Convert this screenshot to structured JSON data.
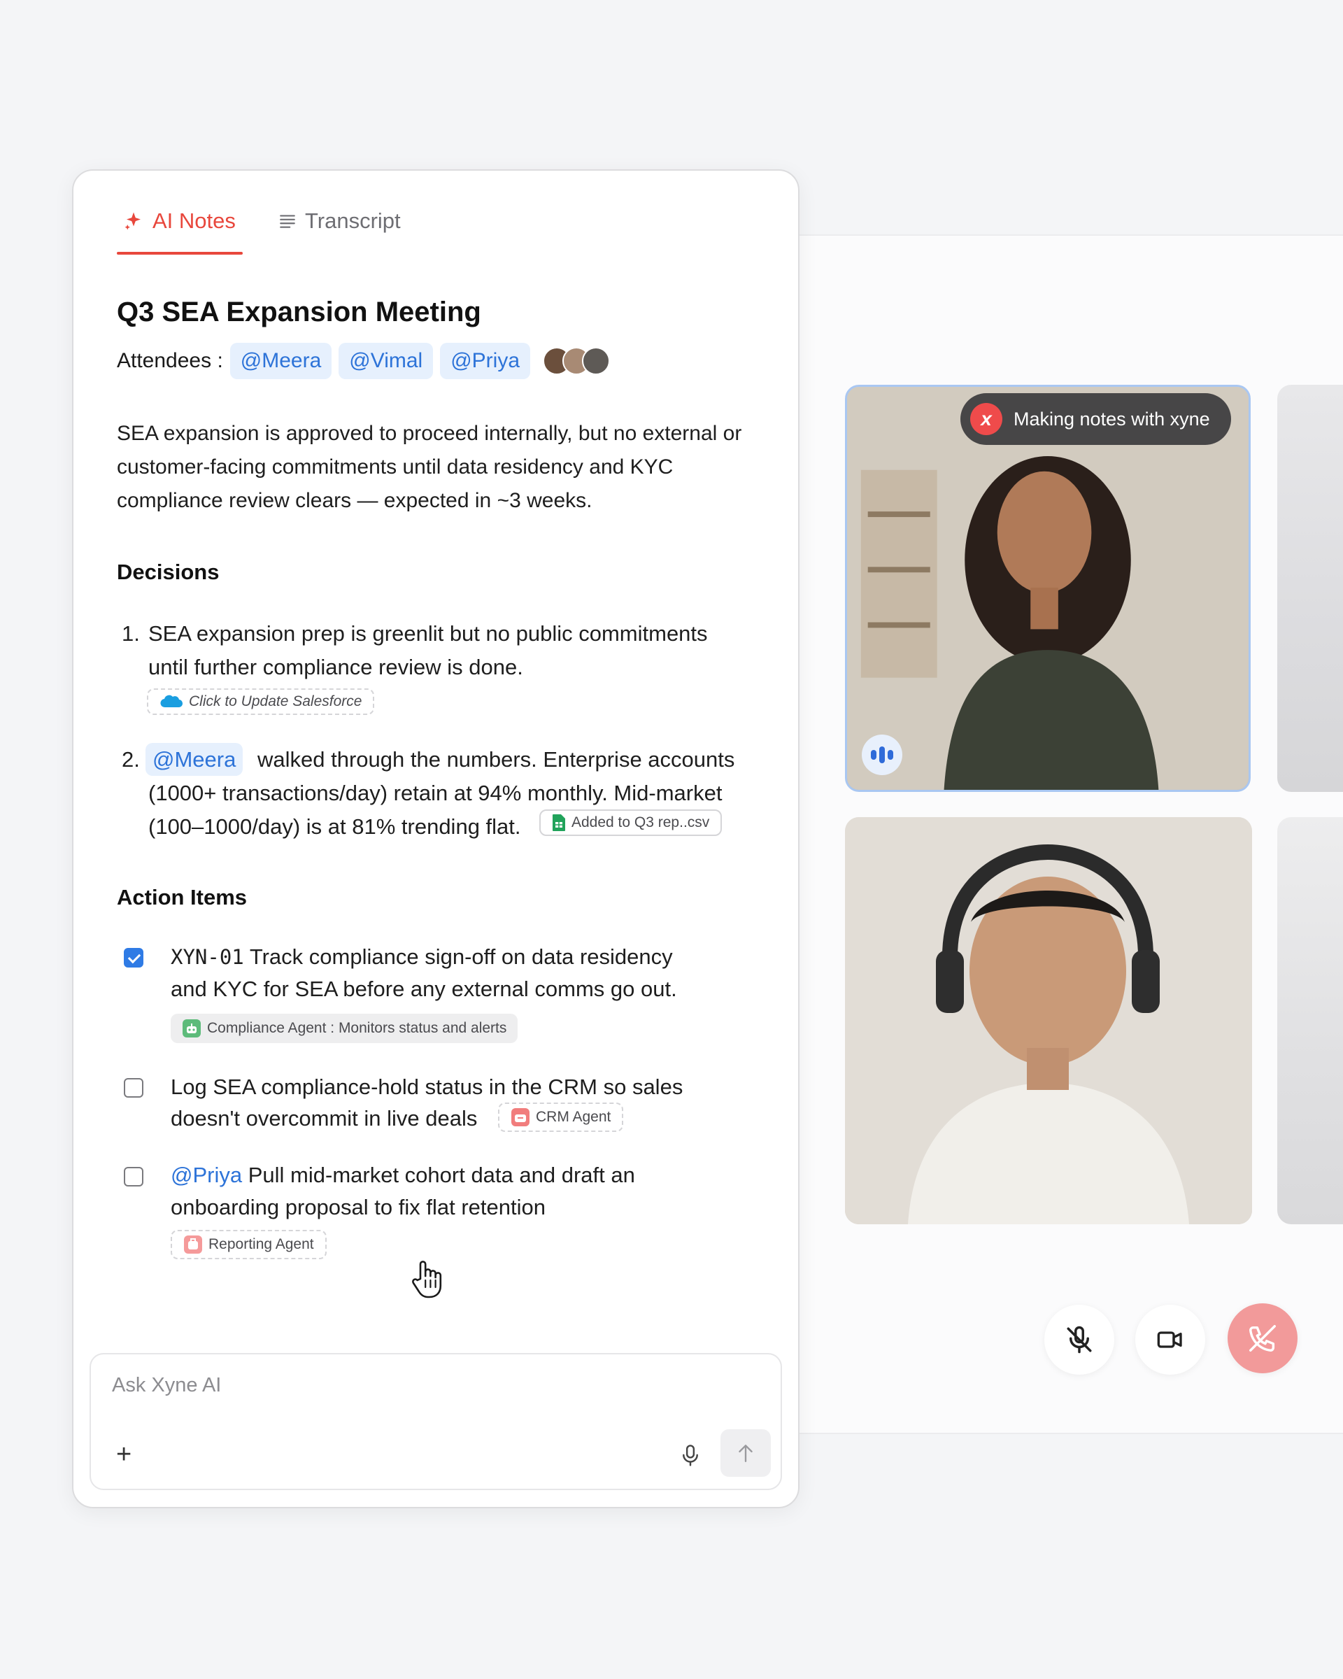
{
  "tabs": {
    "ai_notes": "AI Notes",
    "transcript": "Transcript"
  },
  "meeting": {
    "title": "Q3 SEA Expansion Meeting",
    "attendees_label": "Attendees :",
    "attendees": [
      "@Meera",
      "@Vimal",
      "@Priya"
    ],
    "summary": "SEA expansion is approved to proceed internally, but no external or customer-facing commitments until data residency and KYC compliance review clears — expected in ~3 weeks."
  },
  "decisions": {
    "heading": "Decisions",
    "items": [
      {
        "number": "1.",
        "line1": "SEA expansion prep is greenlit but no public commitments",
        "line2": "until further compliance review is done.",
        "chip": "Click to Update Salesforce"
      },
      {
        "number": "2.",
        "mention": "@Meera",
        "line1": "walked through the numbers. Enterprise accounts",
        "line2": "(1000+ transactions/day) retain at 94% monthly. Mid-market",
        "line3": "(100–1000/day) is at 81% trending flat.",
        "chip": "Added to Q3 rep..csv"
      }
    ]
  },
  "action_items": {
    "heading": "Action Items",
    "items": [
      {
        "checked": true,
        "code": "XYN-01",
        "line1": "Track compliance sign-off on data residency",
        "line2": "and KYC for SEA before any external comms go out.",
        "agent": "Compliance Agent : Monitors status and alerts"
      },
      {
        "checked": false,
        "line1": "Log SEA compliance-hold status in the CRM so sales",
        "line2": "doesn't overcommit in live deals",
        "agent": "CRM Agent"
      },
      {
        "checked": false,
        "mention": "@Priya",
        "line1": "Pull mid-market cohort data and draft an",
        "line2": "onboarding proposal to fix flat retention",
        "agent": "Reporting Agent"
      }
    ]
  },
  "composer": {
    "placeholder": "Ask Xyne AI",
    "plus": "+"
  },
  "call": {
    "notes_badge": "Making notes with xyne",
    "logo_letter": "x"
  },
  "colors": {
    "accent_red": "#e8473c",
    "mention_blue": "#2d73d8",
    "end_call": "#f29a9a"
  }
}
